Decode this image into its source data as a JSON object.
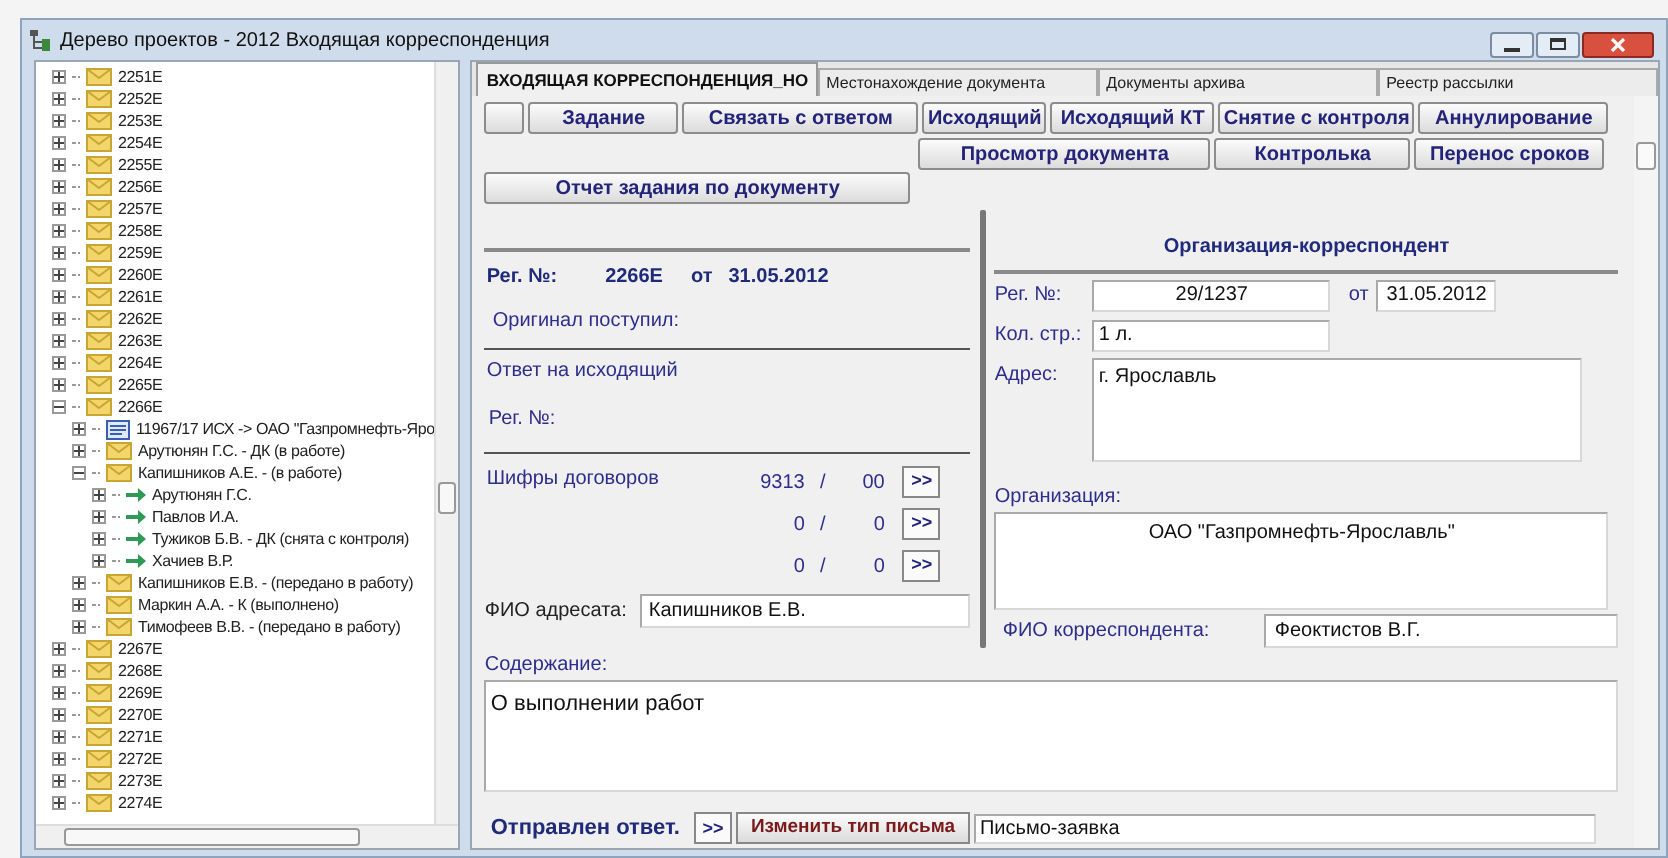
{
  "window": {
    "title": "Дерево проектов - 2012 Входящая корреспонденция"
  },
  "tree": {
    "items": [
      {
        "label": "2251E",
        "kind": "folder",
        "expanded": false
      },
      {
        "label": "2252E",
        "kind": "folder",
        "expanded": false
      },
      {
        "label": "2253E",
        "kind": "folder",
        "expanded": false
      },
      {
        "label": "2254E",
        "kind": "folder",
        "expanded": false
      },
      {
        "label": "2255E",
        "kind": "folder",
        "expanded": false
      },
      {
        "label": "2256E",
        "kind": "folder",
        "expanded": false
      },
      {
        "label": "2257E",
        "kind": "folder",
        "expanded": false
      },
      {
        "label": "2258E",
        "kind": "folder",
        "expanded": false
      },
      {
        "label": "2259E",
        "kind": "folder",
        "expanded": false
      },
      {
        "label": "2260E",
        "kind": "folder",
        "expanded": false
      },
      {
        "label": "2261E",
        "kind": "folder",
        "expanded": false
      },
      {
        "label": "2262E",
        "kind": "folder",
        "expanded": false
      },
      {
        "label": "2263E",
        "kind": "folder",
        "expanded": false
      },
      {
        "label": "2264E",
        "kind": "folder",
        "expanded": false
      },
      {
        "label": "2265E",
        "kind": "folder",
        "expanded": false
      },
      {
        "label": "2266E",
        "kind": "folder",
        "expanded": true,
        "children": [
          {
            "label": "11967/17 ИСХ -> ОАО \"Газпромнефть-Яро",
            "kind": "document",
            "expanded": false
          },
          {
            "label": "Арутюнян Г.С. - ДК (в работе)",
            "kind": "folder",
            "expanded": false
          },
          {
            "label": "Капишников А.Е. - (в работе)",
            "kind": "folder",
            "expanded": true,
            "children": [
              {
                "label": "Арутюнян Г.С.",
                "kind": "arrow",
                "expanded": false
              },
              {
                "label": "Павлов И.А.",
                "kind": "arrow",
                "expanded": false
              },
              {
                "label": "Тужиков Б.В. - ДК (снята с контроля)",
                "kind": "arrow",
                "expanded": false
              },
              {
                "label": "Хачиев В.Р.",
                "kind": "arrow",
                "expanded": false
              }
            ]
          },
          {
            "label": "Капишников Е.В. - (передано в работу)",
            "kind": "folder",
            "expanded": false
          },
          {
            "label": "Маркин А.А. - К (выполнено)",
            "kind": "folder",
            "expanded": false
          },
          {
            "label": "Тимофеев В.В. - (передано в работу)",
            "kind": "folder",
            "expanded": false
          }
        ]
      },
      {
        "label": "2267E",
        "kind": "folder",
        "expanded": false
      },
      {
        "label": "2268E",
        "kind": "folder",
        "expanded": false
      },
      {
        "label": "2269E",
        "kind": "folder",
        "expanded": false
      },
      {
        "label": "2270E",
        "kind": "folder",
        "expanded": false
      },
      {
        "label": "2271E",
        "kind": "folder",
        "expanded": false
      },
      {
        "label": "2272E",
        "kind": "folder",
        "expanded": false
      },
      {
        "label": "2273E",
        "kind": "folder",
        "expanded": false
      },
      {
        "label": "2274E",
        "kind": "folder",
        "expanded": false
      }
    ]
  },
  "tabs": [
    {
      "label": "ВХОДЯЩАЯ КОРРЕСПОНДЕНЦИЯ_НО",
      "selected": true
    },
    {
      "label": "Местонахождение документа",
      "selected": false
    },
    {
      "label": "Документы архива",
      "selected": false
    },
    {
      "label": "Реестр рассылки",
      "selected": false
    }
  ],
  "toolbar": {
    "row_1": [
      "Задание",
      "Связать с ответом",
      "Исходящий",
      "Исходящий КТ",
      "Снятие с контроля",
      "Аннулирование"
    ],
    "row_2": [
      "Просмотр документа",
      "Контролька",
      "Перенос сроков"
    ],
    "report_button": "Отчет задания по документу"
  },
  "document": {
    "reg_label": "Рег. №:",
    "reg_number": "2266E",
    "from_label": "от",
    "date": "31.05.2012",
    "original_label": "Оригинал поступил:",
    "reply_heading": "Ответ на исходящий",
    "reply_reg_label": "Рег. №:",
    "contracts_label": "Шифры договоров",
    "contracts": [
      {
        "code": "9313",
        "separator": "/",
        "sub": "00",
        "button": ">>"
      },
      {
        "code": "0",
        "separator": "/",
        "sub": "0",
        "button": ">>"
      },
      {
        "code": "0",
        "separator": "/",
        "sub": "0",
        "button": ">>"
      }
    ],
    "addressee_label": "ФИО адресата:",
    "addressee": "Капишников Е.В."
  },
  "correspondent": {
    "title": "Организация-корреспондент",
    "reg_label": "Рег. №:",
    "reg_number": "29/1237",
    "from_label": "от",
    "date": "31.05.2012",
    "pages_label": "Кол. стр.:",
    "pages": "1 л.",
    "address_label": "Адрес:",
    "address": "г. Ярославль",
    "organization_label": "Организация:",
    "organization": "ОАО \"Газпромнефть-Ярославль\"",
    "person_label": "ФИО корреспондента:",
    "person": "Феоктистов В.Г."
  },
  "content": {
    "label": "Содержание:",
    "text": "О выполнении работ"
  },
  "footer": {
    "sent_label": "Отправлен ответ.",
    "sent_button": ">>",
    "change_type_button": "Изменить тип письма",
    "letter_type": "Письмо-заявка"
  }
}
